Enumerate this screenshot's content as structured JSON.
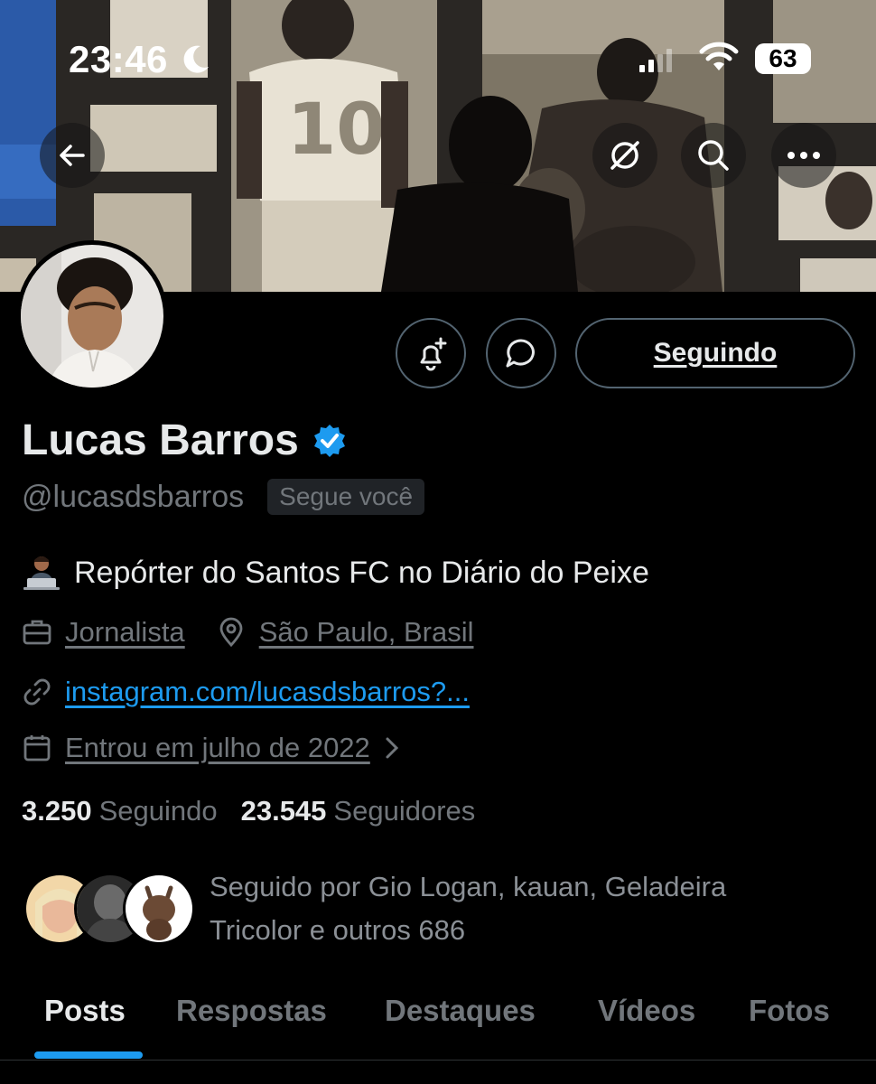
{
  "status_bar": {
    "time": "23:46",
    "battery": "63",
    "icons": [
      "moon-icon",
      "signal-icon",
      "wifi-icon",
      "battery-icon"
    ]
  },
  "nav": {
    "icons": [
      "back-arrow-icon",
      "grok-icon",
      "search-icon",
      "more-icon"
    ]
  },
  "profile": {
    "display_name": "Lucas Barros",
    "handle": "@lucasdsbarros",
    "follows_you": "Segue você",
    "bio": "Repórter do Santos FC no Diário do Peixe",
    "profession": "Jornalista",
    "location": "São Paulo, Brasil",
    "website": "instagram.com/lucasdsbarros?...",
    "joined": "Entrou em julho de 2022",
    "following_count": "3.250",
    "following_label": "Seguindo",
    "followers_count": "23.545",
    "followers_label": "Seguidores",
    "followed_by_line1": "Seguido por Gio Logan, kauan, Geladeira",
    "followed_by_line2": "Tricolor e outros 686"
  },
  "actions": {
    "follow_state": "Seguindo"
  },
  "tabs": [
    {
      "label": "Posts",
      "active": true
    },
    {
      "label": "Respostas",
      "active": false
    },
    {
      "label": "Destaques",
      "active": false
    },
    {
      "label": "Vídeos",
      "active": false
    },
    {
      "label": "Fotos",
      "active": false
    }
  ],
  "colors": {
    "accent": "#1d9bf0",
    "background": "#000000",
    "text_primary": "#e7e9ea",
    "text_secondary": "#71767b"
  }
}
